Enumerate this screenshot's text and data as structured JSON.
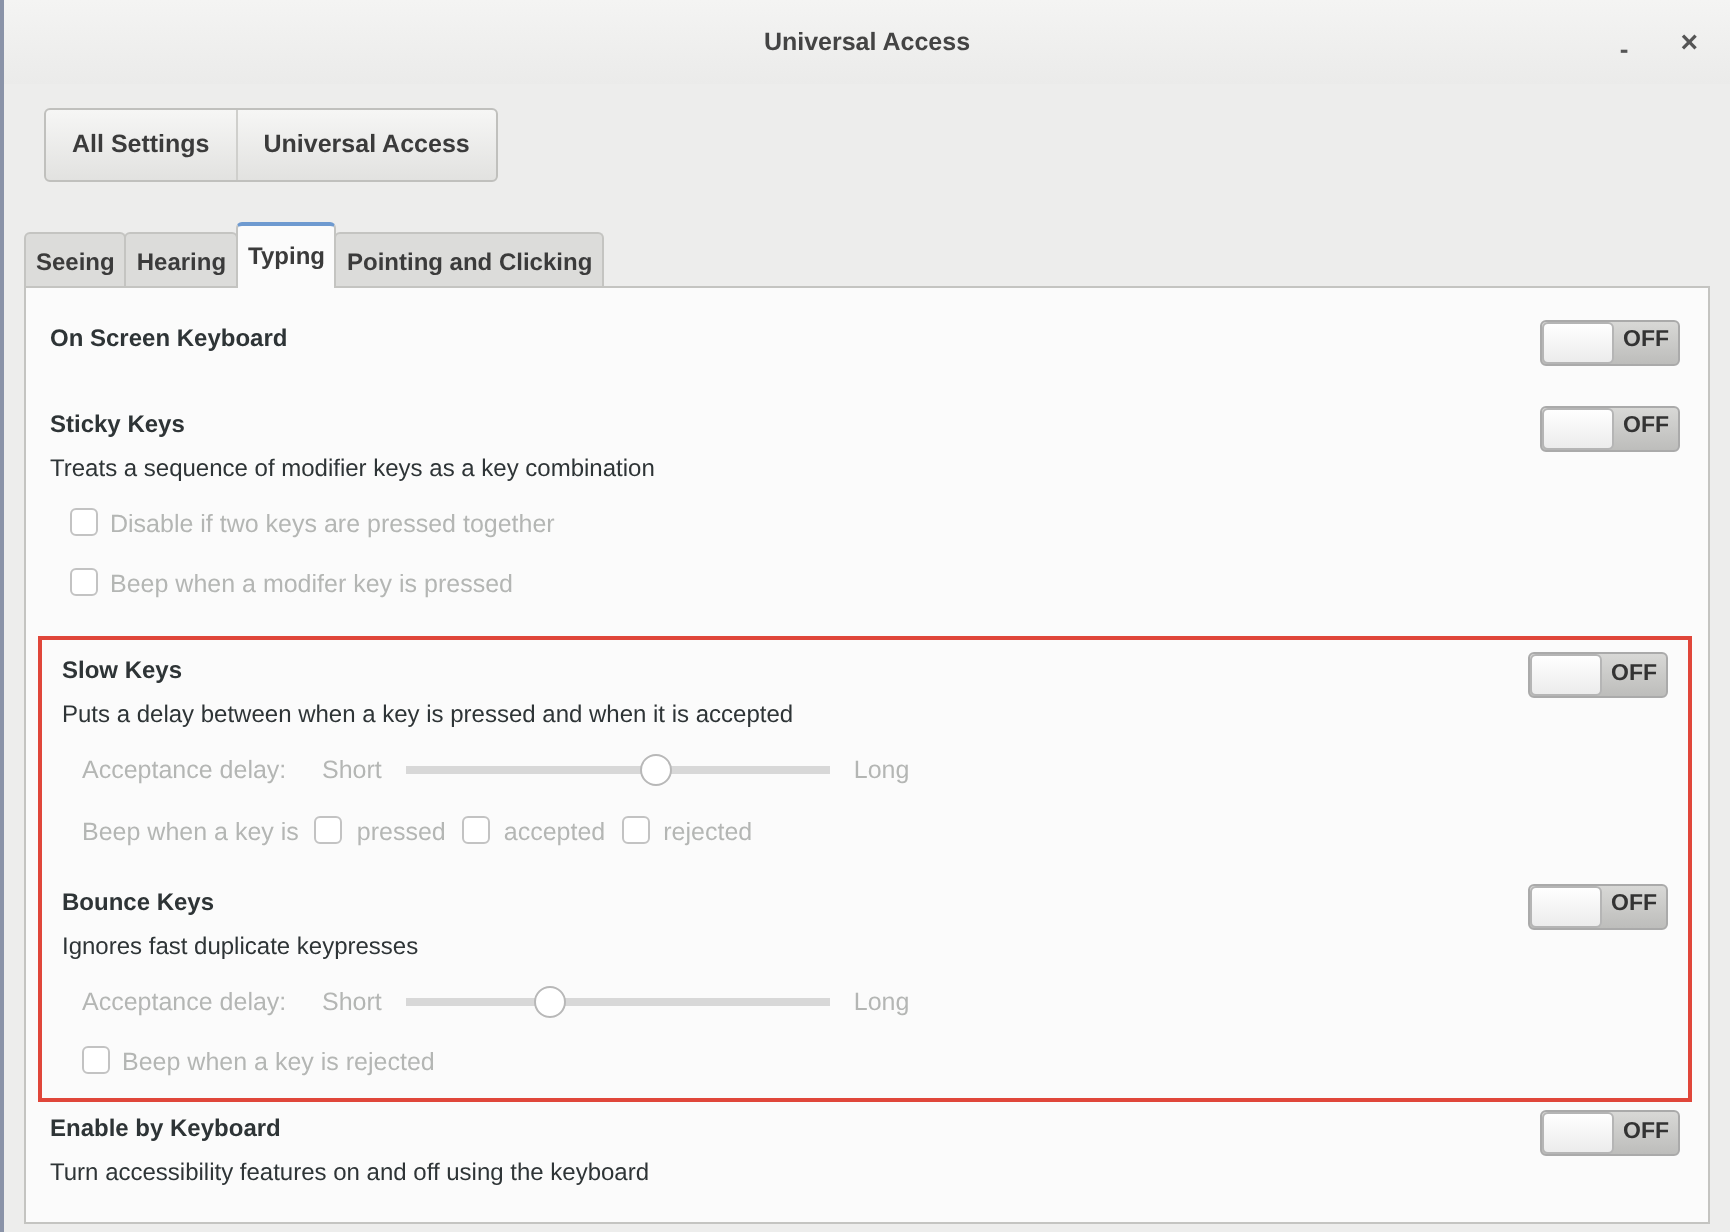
{
  "window": {
    "title": "Universal Access",
    "controls": [
      {
        "kind": "minimize",
        "label": "-"
      },
      {
        "kind": "close",
        "label": "×"
      }
    ]
  },
  "breadcrumbs": [
    {
      "label": "All Settings"
    },
    {
      "label": "Universal Access"
    }
  ],
  "tabs": [
    {
      "label": "Seeing",
      "selected": false
    },
    {
      "label": "Hearing",
      "selected": false
    },
    {
      "label": "Typing",
      "selected": true
    },
    {
      "label": "Pointing and Clicking",
      "selected": false
    }
  ],
  "sections": [
    {
      "title": "On Screen Keyboard",
      "highlighted": false,
      "switch": {
        "on": false,
        "label": "OFF"
      }
    },
    {
      "title": "Sticky Keys",
      "description": "Treats a sequence of modifier keys as a key combination",
      "highlighted": false,
      "switch": {
        "on": false,
        "label": "OFF"
      },
      "options": [
        {
          "kind": "checkbox",
          "label": "Disable if two keys are pressed together",
          "checked": false,
          "disabled": true
        },
        {
          "kind": "checkbox",
          "label": "Beep when a modifer key is pressed",
          "checked": false,
          "disabled": true
        }
      ]
    },
    {
      "title": "Slow Keys",
      "description": "Puts a delay between when a key is pressed and when it is accepted",
      "highlighted": true,
      "switch": {
        "on": false,
        "label": "OFF"
      },
      "options": [
        {
          "kind": "slider",
          "label": "Acceptance delay:",
          "min_label": "Short",
          "max_label": "Long",
          "level": 0.59,
          "disabled": true
        },
        {
          "kind": "checkbox_row",
          "label": "Beep when a key is",
          "disabled": true,
          "items": [
            {
              "label": "pressed",
              "checked": false
            },
            {
              "label": "accepted",
              "checked": false
            },
            {
              "label": "rejected",
              "checked": false
            }
          ]
        }
      ]
    },
    {
      "title": "Bounce Keys",
      "description": "Ignores fast duplicate keypresses",
      "highlighted": true,
      "switch": {
        "on": false,
        "label": "OFF"
      },
      "options": [
        {
          "kind": "slider",
          "label": "Acceptance delay:",
          "min_label": "Short",
          "max_label": "Long",
          "level": 0.34,
          "disabled": true
        },
        {
          "kind": "checkbox",
          "label": "Beep when a key is rejected",
          "checked": false,
          "disabled": true
        }
      ]
    },
    {
      "title": "Enable by Keyboard",
      "description": "Turn accessibility features on and off using the keyboard",
      "highlighted": false,
      "switch": {
        "on": false,
        "label": "OFF"
      }
    }
  ]
}
